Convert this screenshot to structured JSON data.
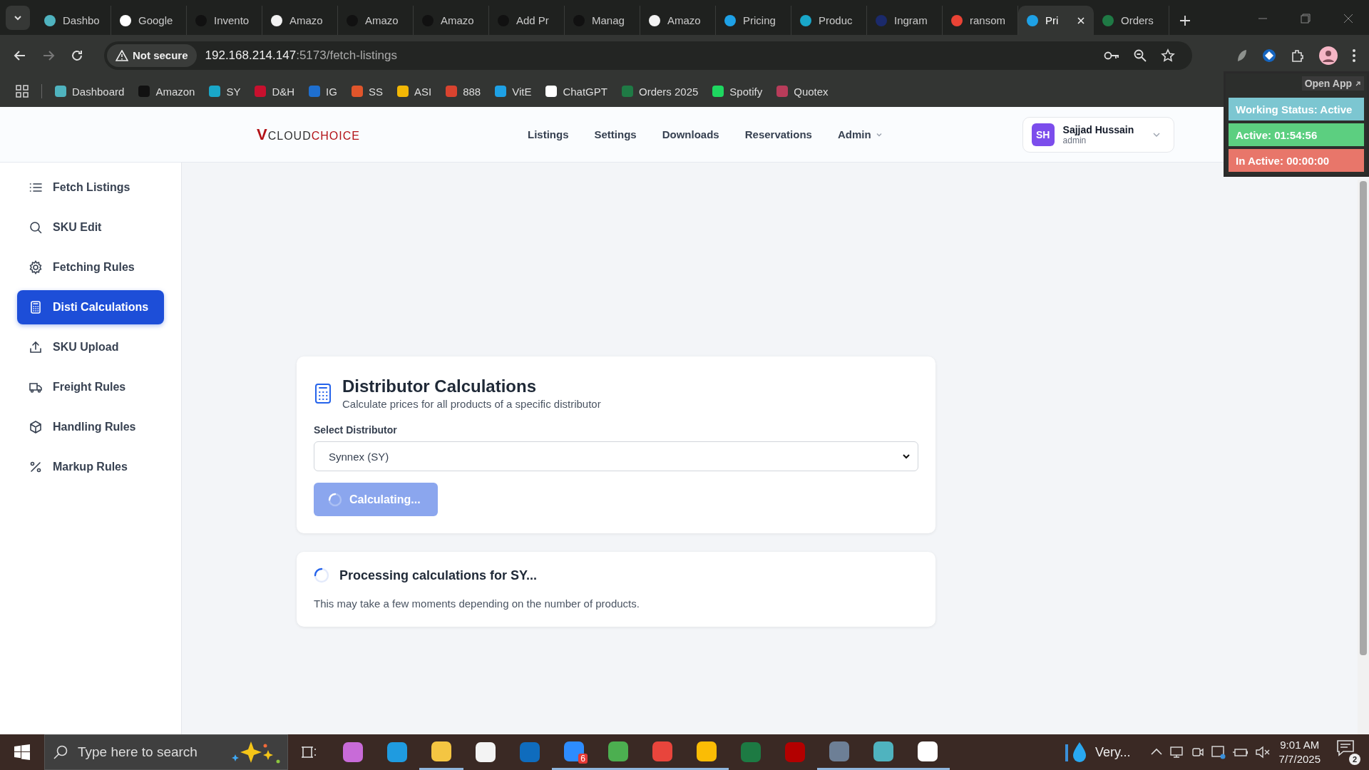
{
  "browser": {
    "tabs": [
      {
        "label": "Dashbo",
        "color": "#4fb3bf",
        "selected": false
      },
      {
        "label": "Google",
        "color": "#ffffff",
        "selected": false
      },
      {
        "label": "Invento",
        "color": "#111111",
        "selected": false
      },
      {
        "label": "Amazo",
        "color": "#f2f2f2",
        "selected": false
      },
      {
        "label": "Amazo",
        "color": "#111111",
        "selected": false
      },
      {
        "label": "Amazo",
        "color": "#111111",
        "selected": false
      },
      {
        "label": "Add Pr",
        "color": "#111111",
        "selected": false
      },
      {
        "label": "Manag",
        "color": "#111111",
        "selected": false
      },
      {
        "label": "Amazo",
        "color": "#f2f2f2",
        "selected": false
      },
      {
        "label": "Pricing",
        "color": "#1ea1e6",
        "selected": false
      },
      {
        "label": "Produc",
        "color": "#19a7c9",
        "selected": false
      },
      {
        "label": "Ingram",
        "color": "#1b2a6b",
        "selected": false
      },
      {
        "label": "ransom",
        "color": "#ea4335",
        "selected": false
      },
      {
        "label": "Pri",
        "color": "#1ea1e6",
        "selected": true
      },
      {
        "label": "Orders",
        "color": "#1f7a45",
        "selected": false
      }
    ],
    "address": {
      "security": "Not secure",
      "host": "192.168.214.147",
      "path": ":5173/fetch-listings"
    },
    "bookmarks": [
      {
        "label": "Dashboard",
        "color": "#4fb3bf"
      },
      {
        "label": "Amazon",
        "color": "#111111"
      },
      {
        "label": "SY",
        "color": "#19a7c9"
      },
      {
        "label": "D&H",
        "color": "#c8102e"
      },
      {
        "label": "IG",
        "color": "#1e6fd0"
      },
      {
        "label": "SS",
        "color": "#e0552b"
      },
      {
        "label": "ASI",
        "color": "#f2b705"
      },
      {
        "label": "888",
        "color": "#d9432f"
      },
      {
        "label": "VitE",
        "color": "#1ea1e6"
      },
      {
        "label": "ChatGPT",
        "color": "#ffffff"
      },
      {
        "label": "Orders 2025",
        "color": "#1f7a45"
      },
      {
        "label": "Spotify",
        "color": "#1ed760"
      },
      {
        "label": "Quotex",
        "color": "#b83c5a"
      }
    ]
  },
  "app": {
    "logo": {
      "mark": "V",
      "part_a": "CLOUD",
      "part_b": "CHOICE"
    },
    "nav": [
      {
        "label": "Listings",
        "has_menu": false
      },
      {
        "label": "Settings",
        "has_menu": false
      },
      {
        "label": "Downloads",
        "has_menu": false
      },
      {
        "label": "Reservations",
        "has_menu": false
      },
      {
        "label": "Admin",
        "has_menu": true
      }
    ],
    "user": {
      "initials": "SH",
      "name": "Sajjad Hussain",
      "role": "admin"
    },
    "sidebar": [
      {
        "label": "Fetch Listings",
        "kind": "list",
        "selected": false
      },
      {
        "label": "SKU Edit",
        "kind": "search",
        "selected": false
      },
      {
        "label": "Fetching Rules",
        "kind": "gear",
        "selected": false
      },
      {
        "label": "Disti Calculations",
        "kind": "calculator",
        "selected": true
      },
      {
        "label": "SKU Upload",
        "kind": "upload",
        "selected": false
      },
      {
        "label": "Freight Rules",
        "kind": "truck",
        "selected": false
      },
      {
        "label": "Handling Rules",
        "kind": "box",
        "selected": false
      },
      {
        "label": "Markup Rules",
        "kind": "percent",
        "selected": false
      }
    ],
    "card": {
      "title": "Distributor Calculations",
      "subtitle": "Calculate prices for all products of a specific distributor",
      "field_label": "Select Distributor",
      "value": "Synnex (SY)",
      "button": "Calculating...",
      "busy": true
    },
    "progress": {
      "message": "Processing calculations for SY...",
      "note": "This may take a few moments depending on the number of products."
    }
  },
  "status_widget": {
    "open_app": "Open App",
    "rows": [
      {
        "label": "Working Status: Active",
        "color": "#7cc6d1"
      },
      {
        "label": "Active: 01:54:56",
        "color": "#5ccf80"
      },
      {
        "label": "In Active: 00:00:00",
        "color": "#e8766a"
      }
    ]
  },
  "taskbar": {
    "search_placeholder": "Type here to search",
    "apps": [
      {
        "color": "#c86bd8",
        "open": false
      },
      {
        "color": "#1f9be0",
        "open": false
      },
      {
        "color": "#f4c542",
        "open": true
      },
      {
        "color": "#f3f3f3",
        "open": false
      },
      {
        "color": "#0f6cbd",
        "open": false
      },
      {
        "color": "#2d8cff",
        "open": true,
        "badge": "6"
      },
      {
        "color": "#4caf50",
        "open": true
      },
      {
        "color": "#e8453c",
        "open": true
      },
      {
        "color": "#fbbc05",
        "open": true
      },
      {
        "color": "#1d7a43",
        "open": false
      },
      {
        "color": "#b30000",
        "open": false
      },
      {
        "color": "#6d7f96",
        "open": true
      },
      {
        "color": "#4fb3bf",
        "open": true
      },
      {
        "color": "#ffffff",
        "open": true
      }
    ],
    "weather": "Very...",
    "time": "9:01 AM",
    "date": "7/7/2025",
    "notifications": "2"
  }
}
